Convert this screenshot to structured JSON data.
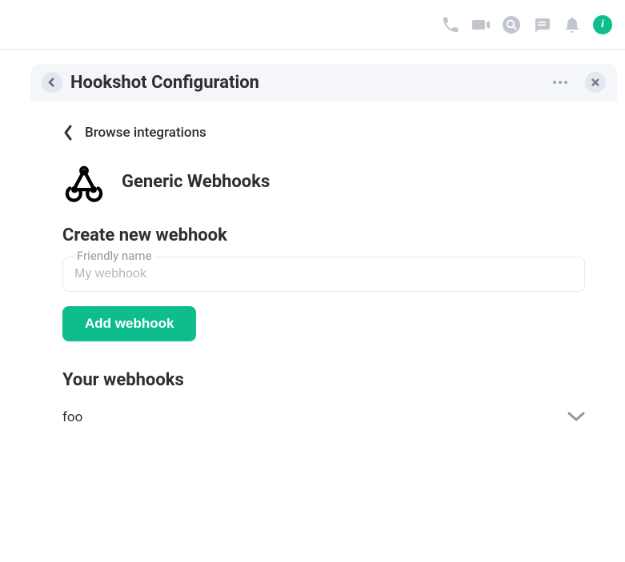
{
  "topbar": {
    "icons": [
      "phone",
      "video",
      "search",
      "chat",
      "bell",
      "info"
    ]
  },
  "panel": {
    "title": "Hookshot Configuration",
    "browse_label": "Browse integrations",
    "integration": {
      "name": "Generic Webhooks"
    },
    "create": {
      "heading": "Create new webhook",
      "field_label": "Friendly name",
      "field_placeholder": "My webhook",
      "button_label": "Add webhook"
    },
    "list_heading": "Your webhooks",
    "webhooks": [
      {
        "name": "foo"
      }
    ]
  }
}
